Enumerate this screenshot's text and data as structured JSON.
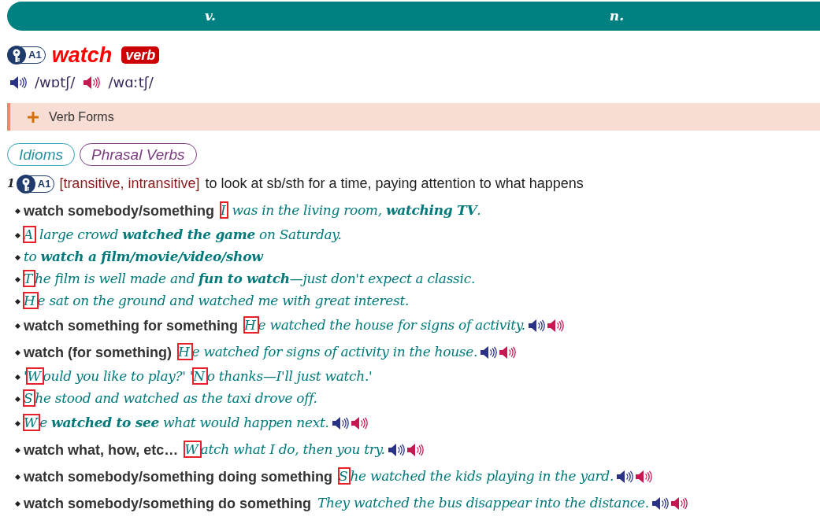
{
  "tabs": [
    {
      "label": "v."
    },
    {
      "label": "n."
    }
  ],
  "headword": {
    "level": "A1",
    "word": "watch",
    "pos": "verb"
  },
  "pronunciations": [
    {
      "ipa": "/wɒtʃ/"
    },
    {
      "ipa": "/wɑːtʃ/"
    }
  ],
  "verb_forms": {
    "label": "Verb Forms"
  },
  "links": [
    {
      "label": "Idioms",
      "kind": "idioms"
    },
    {
      "label": "Phrasal Verbs",
      "kind": "phrasal"
    }
  ],
  "sense": {
    "number": "1",
    "level": "A1",
    "grammar": "[transitive, intransitive]",
    "definition": "to look at sb/sth for a time, paying attention to what happens"
  },
  "entries": [
    {
      "pattern": "watch somebody/something",
      "parts": [
        {
          "text": "I was in the living room, **watching TV**.",
          "highlighted": true
        }
      ],
      "audio": false
    },
    {
      "parts": [
        {
          "text": "A large crowd **watched the game** on Saturday.",
          "highlighted": true
        }
      ],
      "audio": false
    },
    {
      "parts": [
        {
          "text": "to **watch a film/movie/video/show**",
          "highlighted": false
        }
      ],
      "audio": false
    },
    {
      "parts": [
        {
          "text": "The film is well made and **fun to watch**—just don't expect a classic.",
          "highlighted": true
        }
      ],
      "audio": false
    },
    {
      "parts": [
        {
          "text": "He sat on the ground and watched me with great interest.",
          "highlighted": true
        }
      ],
      "audio": false
    },
    {
      "pattern": "watch something for something",
      "parts": [
        {
          "text": "He watched the house for signs of activity.",
          "highlighted": true
        }
      ],
      "audio": true
    },
    {
      "pattern": "watch (for something)",
      "parts": [
        {
          "text": "He watched for signs of activity in the house.",
          "highlighted": true
        }
      ],
      "audio": true
    },
    {
      "parts": [
        {
          "text": "'Would you like to play?'",
          "highlighted": true
        },
        {
          "text": "'No thanks—I'll just watch.'",
          "highlighted": true
        }
      ],
      "audio": false
    },
    {
      "parts": [
        {
          "text": "She stood and watched as the taxi drove off.",
          "highlighted": true
        }
      ],
      "audio": false
    },
    {
      "parts": [
        {
          "text": "We **watched to see** what would happen next.",
          "highlighted": true
        }
      ],
      "audio": true
    },
    {
      "pattern": "watch what, how, etc…",
      "parts": [
        {
          "text": "Watch what I do, then you try.",
          "highlighted": true
        }
      ],
      "audio": true
    },
    {
      "pattern": "watch somebody/something doing something",
      "parts": [
        {
          "text": "She watched the kids playing in the yard.",
          "highlighted": true
        }
      ],
      "audio": true
    },
    {
      "pattern": "watch somebody/something do something",
      "parts": [
        {
          "text": "They watched the bus disappear into the distance.",
          "highlighted": false
        }
      ],
      "audio": true
    }
  ]
}
